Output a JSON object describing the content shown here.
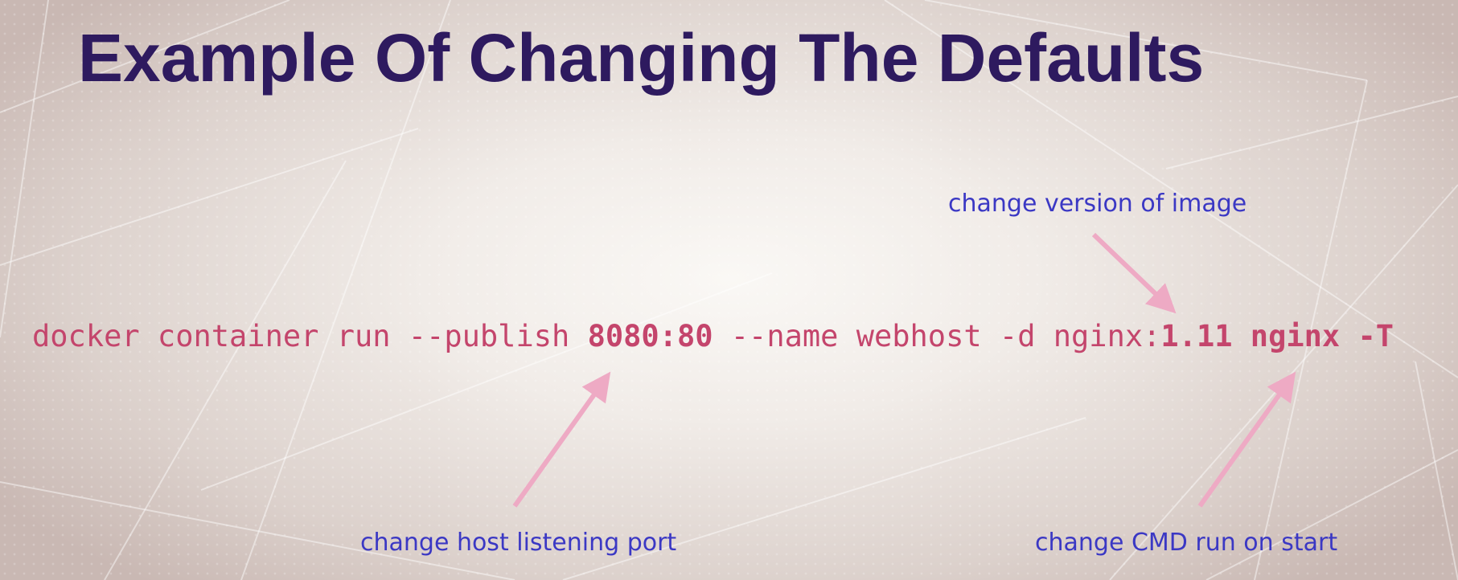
{
  "slide": {
    "title": "Example Of Changing The Defaults"
  },
  "command": {
    "part1": "docker container run --publish ",
    "port_mapping": "8080:80",
    "part2": " --name webhost -d nginx:",
    "image_version": "1.11",
    "space": " ",
    "cmd": "nginx -T"
  },
  "annotations": {
    "version": "change version of image",
    "port": "change host listening port",
    "cmd": "change CMD run on start"
  },
  "colors": {
    "title": "#2e1a5f",
    "command": "#c4456c",
    "annotation": "#3b38c4",
    "arrow": "#eeaac4"
  }
}
